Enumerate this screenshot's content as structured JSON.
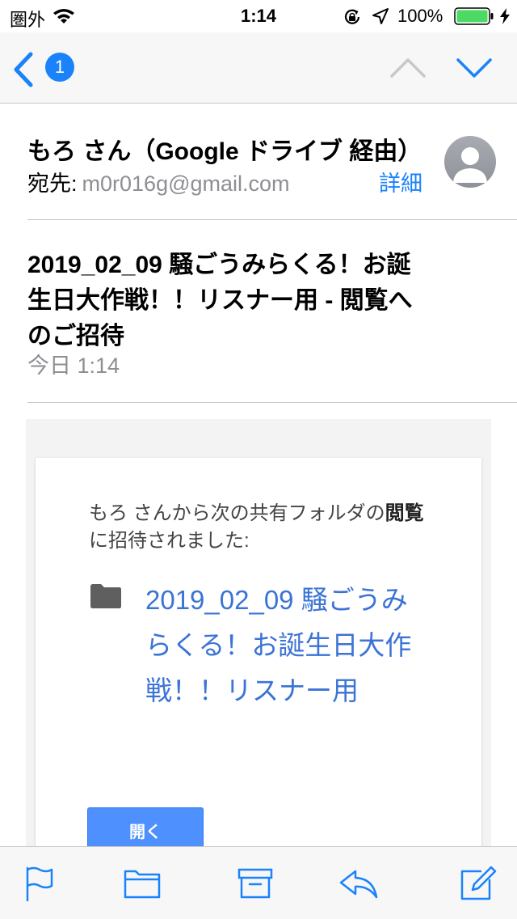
{
  "status_bar": {
    "carrier": "圏外",
    "time": "1:14",
    "battery_percent": "100%",
    "icons": [
      "wifi-icon",
      "lock-rotation-icon",
      "location-icon",
      "battery-icon",
      "charging-icon"
    ]
  },
  "nav": {
    "unread_count": "1",
    "icons": [
      "back-chevron-icon",
      "chevron-up-icon",
      "chevron-down-icon"
    ]
  },
  "header": {
    "sender": "もろ さん（Google ドライブ 経由）",
    "recipient_label": "宛先:",
    "recipient_address": "m0r016g@gmail.com",
    "details_label": "詳細"
  },
  "message": {
    "subject": "2019_02_09 騒ごうみらくる！お誕生日大作戦！！リスナー用 - 閲覧へのご招待",
    "date": "今日 1:14"
  },
  "body": {
    "invite_prefix": "もろ さんから次の共有フォルダの",
    "invite_role": "閲覧",
    "invite_suffix": "に招待されました:",
    "folder_name": "2019_02_09 騒ごうみらくる！お誕生日大作戦！！リスナー用",
    "open_button_label": "開く"
  },
  "toolbar": {
    "icons": [
      "flag-icon",
      "folder-icon",
      "archive-icon",
      "reply-icon",
      "compose-icon"
    ]
  },
  "colors": {
    "accent": "#1a82fb",
    "link": "#3b73d6",
    "button": "#4d90fe",
    "secondary_text": "#8e8e93"
  }
}
